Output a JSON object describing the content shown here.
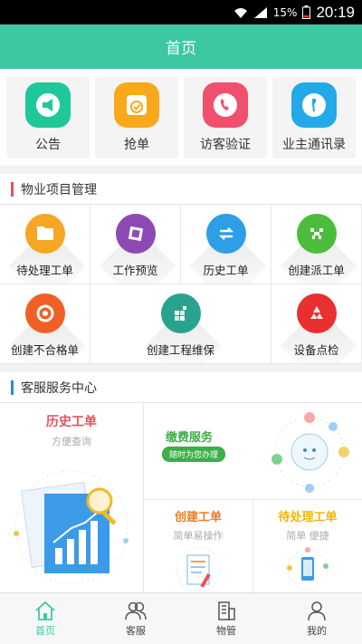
{
  "status_bar": {
    "battery": "15%",
    "time": "20:19"
  },
  "header": {
    "title": "首页"
  },
  "quick_actions": [
    {
      "label": "公告",
      "icon": "megaphone-icon",
      "color": "#1fc89b"
    },
    {
      "label": "抢单",
      "icon": "order-grab-icon",
      "color": "#f9a81a"
    },
    {
      "label": "访客验证",
      "icon": "phone-icon",
      "color": "#f0506e"
    },
    {
      "label": "业主通讯录",
      "icon": "wrench-icon",
      "color": "#22a9e8"
    }
  ],
  "property_section": {
    "title": "物业项目管理",
    "accent": "#e8515f",
    "items": [
      {
        "label": "待处理工单",
        "icon": "folder-icon",
        "color": "#f5a623"
      },
      {
        "label": "工作预览",
        "icon": "preview-icon",
        "color": "#8e4ab4"
      },
      {
        "label": "历史工单",
        "icon": "exchange-icon",
        "color": "#2e9ee6"
      },
      {
        "label": "创建派工单",
        "icon": "creeper-icon",
        "color": "#4cbc3c"
      },
      {
        "label": "创建不合格单",
        "icon": "target-icon",
        "color": "#f06026"
      },
      {
        "label": "创建工程维保",
        "icon": "cube-icon",
        "color": "#2aa38e"
      },
      {
        "label": "设备点检",
        "icon": "recycle-icon",
        "color": "#e83030"
      }
    ]
  },
  "service_section": {
    "title": "客服服务中心",
    "accent": "#2e86de",
    "history": {
      "title": "历史工单",
      "subtitle": "方便查询",
      "color": "#e8515f"
    },
    "payment": {
      "title": "缴费服务",
      "subtitle": "随时为您办理",
      "color": "#3cae4a"
    },
    "create": {
      "title": "创建工单",
      "subtitle": "简单易操作",
      "color": "#f07a20"
    },
    "pending": {
      "title": "待处理工单",
      "subtitle": "简单  便捷",
      "color": "#f5b400"
    }
  },
  "tabbar": [
    {
      "label": "首页",
      "icon": "home-icon",
      "active": true
    },
    {
      "label": "客服",
      "icon": "people-icon",
      "active": false
    },
    {
      "label": "物管",
      "icon": "building-icon",
      "active": false
    },
    {
      "label": "我的",
      "icon": "user-icon",
      "active": false
    }
  ]
}
